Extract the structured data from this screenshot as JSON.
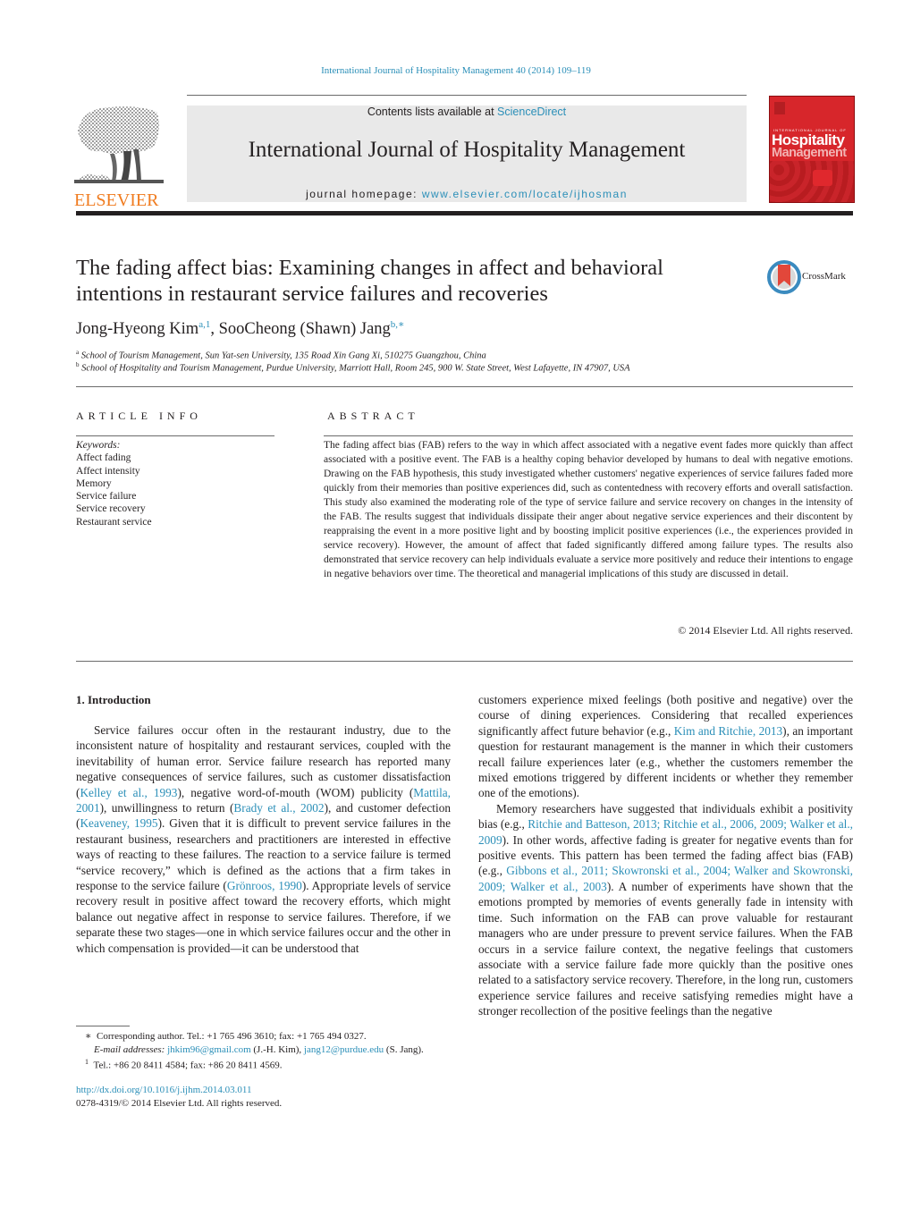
{
  "header": {
    "citation": "International Journal of Hospitality Management 40 (2014) 109–119",
    "contents_prefix": "Contents lists available at ",
    "contents_link": "ScienceDirect",
    "journal_title": "International Journal of Hospitality Management",
    "homepage_prefix": "journal homepage: ",
    "homepage_link": "www.elsevier.com/locate/ijhosman",
    "publisher_logo": "ELSEVIER",
    "cover": {
      "line1": "INTERNATIONAL JOURNAL OF",
      "line2": "Hospitality",
      "line3": "Management"
    },
    "colors": {
      "link": "#2b8fb8",
      "elsevier_orange": "#f07c20",
      "cover_red": "#d7262b",
      "masthead_bg": "#e9e9e9"
    }
  },
  "article": {
    "title": "The fading affect bias: Examining changes in affect and behavioral intentions in restaurant service failures and recoveries",
    "crossmark_label": "CrossMark",
    "authors": [
      {
        "name": "Jong-Hyeong Kim",
        "marks": "a,1"
      },
      {
        "name": "SooCheong (Shawn) Jang",
        "marks": "b,∗"
      }
    ],
    "author_separator": ", ",
    "affiliations": [
      {
        "mark": "a",
        "text": "School of Tourism Management, Sun Yat-sen University, 135 Road Xin Gang Xi, 510275 Guangzhou, China"
      },
      {
        "mark": "b",
        "text": "School of Hospitality and Tourism Management, Purdue University, Marriott Hall, Room 245, 900 W. State Street, West Lafayette, IN 47907, USA"
      }
    ]
  },
  "article_info": {
    "heading": "ARTICLE INFO",
    "keywords_label": "Keywords:",
    "keywords": [
      "Affect fading",
      "Affect intensity",
      "Memory",
      "Service failure",
      "Service recovery",
      "Restaurant service"
    ]
  },
  "abstract": {
    "heading": "ABSTRACT",
    "text": "The fading affect bias (FAB) refers to the way in which affect associated with a negative event fades more quickly than affect associated with a positive event. The FAB is a healthy coping behavior developed by humans to deal with negative emotions. Drawing on the FAB hypothesis, this study investigated whether customers' negative experiences of service failures faded more quickly from their memories than positive experiences did, such as contentedness with recovery efforts and overall satisfaction. This study also examined the moderating role of the type of service failure and service recovery on changes in the intensity of the FAB. The results suggest that individuals dissipate their anger about negative service experiences and their discontent by reappraising the event in a more positive light and by boosting implicit positive experiences (i.e., the experiences provided in service recovery). However, the amount of affect that faded significantly differed among failure types. The results also demonstrated that service recovery can help individuals evaluate a service more positively and reduce their intentions to engage in negative behaviors over time. The theoretical and managerial implications of this study are discussed in detail.",
    "copyright": "© 2014 Elsevier Ltd. All rights reserved."
  },
  "body": {
    "section_heading": "1.  Introduction",
    "left_paragraph": [
      {
        "t": "Service failures occur often in the restaurant industry, due to the inconsistent nature of hospitality and restaurant services, coupled with the inevitability of human error. Service failure research has reported many negative consequences of service failures, such as customer dissatisfaction ("
      },
      {
        "link": "Kelley et al., 1993"
      },
      {
        "t": "), negative word-of-mouth (WOM) publicity ("
      },
      {
        "link": "Mattila, 2001"
      },
      {
        "t": "), unwillingness to return ("
      },
      {
        "link": "Brady et al., 2002"
      },
      {
        "t": "), and customer defection ("
      },
      {
        "link": "Keaveney, 1995"
      },
      {
        "t": "). Given that it is difficult to prevent service failures in the restaurant business, researchers and practitioners are interested in effective ways of reacting to these failures. The reaction to a service failure is termed “service recovery,” which is defined as the actions that a firm takes in response to the service failure ("
      },
      {
        "link": "Grönroos, 1990"
      },
      {
        "t": "). Appropriate levels of service recovery result in positive affect toward the recovery efforts, which might balance out negative affect in response to service failures. Therefore, if we separate these two stages—one in which service failures occur and the other in which compensation is provided—it can be understood that"
      }
    ],
    "right_paragraph_1": [
      {
        "t": "customers experience mixed feelings (both positive and negative) over the course of dining experiences. Considering that recalled experiences significantly affect future behavior (e.g., "
      },
      {
        "link": "Kim and Ritchie, 2013"
      },
      {
        "t": "), an important question for restaurant management is the manner in which their customers recall failure experiences later (e.g., whether the customers remember the mixed emotions triggered by different incidents or whether they remember one of the emotions)."
      }
    ],
    "right_paragraph_2": [
      {
        "t": "Memory researchers have suggested that individuals exhibit a positivity bias (e.g., "
      },
      {
        "link": "Ritchie and Batteson, 2013; Ritchie et al., 2006, 2009; Walker et al., 2009"
      },
      {
        "t": "). In other words, affective fading is greater for negative events than for positive events. This pattern has been termed the fading affect bias (FAB) (e.g., "
      },
      {
        "link": "Gibbons et al., 2011; Skowronski et al., 2004; Walker and Skowronski, 2009; Walker et al., 2003"
      },
      {
        "t": "). A number of experiments have shown that the emotions prompted by memories of events generally fade in intensity with time. Such information on the FAB can prove valuable for restaurant managers who are under pressure to prevent service failures. When the FAB occurs in a service failure context, the negative feelings that customers associate with a service failure fade more quickly than the positive ones related to a satisfactory service recovery. Therefore, in the long run, customers experience service failures and receive satisfying remedies might have a stronger recollection of the positive feelings than the negative"
      }
    ]
  },
  "footnotes": {
    "corresponding_mark": "∗",
    "corresponding": "Corresponding author. Tel.: +1 765 496 3610; fax: +1 765 494 0327.",
    "email_label": "E-mail addresses:",
    "email_1": "jhkim96@gmail.com",
    "email_1_owner": " (J.-H. Kim), ",
    "email_2": "jang12@purdue.edu",
    "email_2_owner": " (S. Jang).",
    "note_1_mark": "1",
    "note_1": "Tel.: +86 20 8411 4584; fax: +86 20 8411 4569."
  },
  "doi": {
    "link": "http://dx.doi.org/10.1016/j.ijhm.2014.03.011",
    "issn_line": "0278-4319/© 2014 Elsevier Ltd. All rights reserved."
  }
}
